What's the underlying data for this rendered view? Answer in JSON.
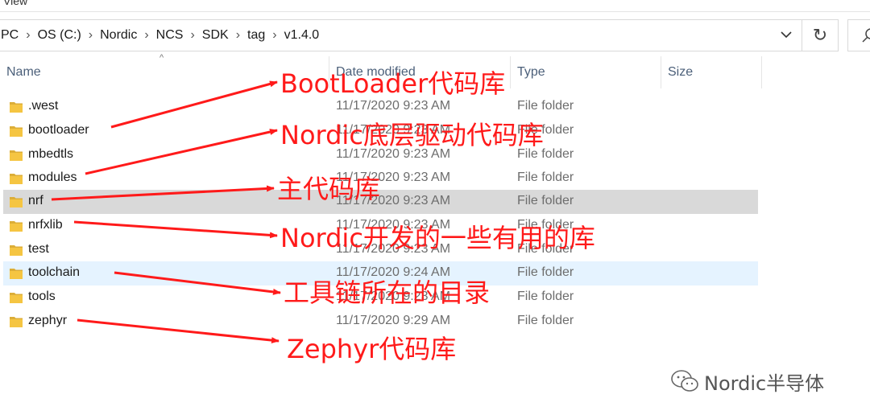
{
  "menu": {
    "label": "View"
  },
  "address": {
    "crumbs": [
      "PC",
      "OS (C:)",
      "Nordic",
      "NCS",
      "SDK",
      "tag",
      "v1.4.0"
    ]
  },
  "columns": {
    "name": "Name",
    "date": "Date modified",
    "type": "Type",
    "size": "Size"
  },
  "files": [
    {
      "name": ".west",
      "date": "11/17/2020 9:23 AM",
      "type": "File folder"
    },
    {
      "name": "bootloader",
      "date": "11/17/2020 9:23 AM",
      "type": "File folder"
    },
    {
      "name": "mbedtls",
      "date": "11/17/2020 9:23 AM",
      "type": "File folder"
    },
    {
      "name": "modules",
      "date": "11/17/2020 9:23 AM",
      "type": "File folder"
    },
    {
      "name": "nrf",
      "date": "11/17/2020 9:23 AM",
      "type": "File folder"
    },
    {
      "name": "nrfxlib",
      "date": "11/17/2020 9:23 AM",
      "type": "File folder"
    },
    {
      "name": "test",
      "date": "11/17/2020 9:23 AM",
      "type": "File folder"
    },
    {
      "name": "toolchain",
      "date": "11/17/2020 9:24 AM",
      "type": "File folder"
    },
    {
      "name": "tools",
      "date": "11/17/2020 9:23 AM",
      "type": "File folder"
    },
    {
      "name": "zephyr",
      "date": "11/17/2020 9:29 AM",
      "type": "File folder"
    }
  ],
  "annotations": [
    "BootLoader代码库",
    "Nordic底层驱动代码库",
    "主代码库",
    "Nordic开发的一些有用的库",
    "工具链所在的目录",
    "Zephyr代码库"
  ],
  "watermark": {
    "text": "Nordic半导体"
  },
  "colors": {
    "annotation": "#ff1a1a",
    "selected_row": "#d9d9d9",
    "hover_row": "#e5f3ff",
    "folder": "#f5c542"
  }
}
